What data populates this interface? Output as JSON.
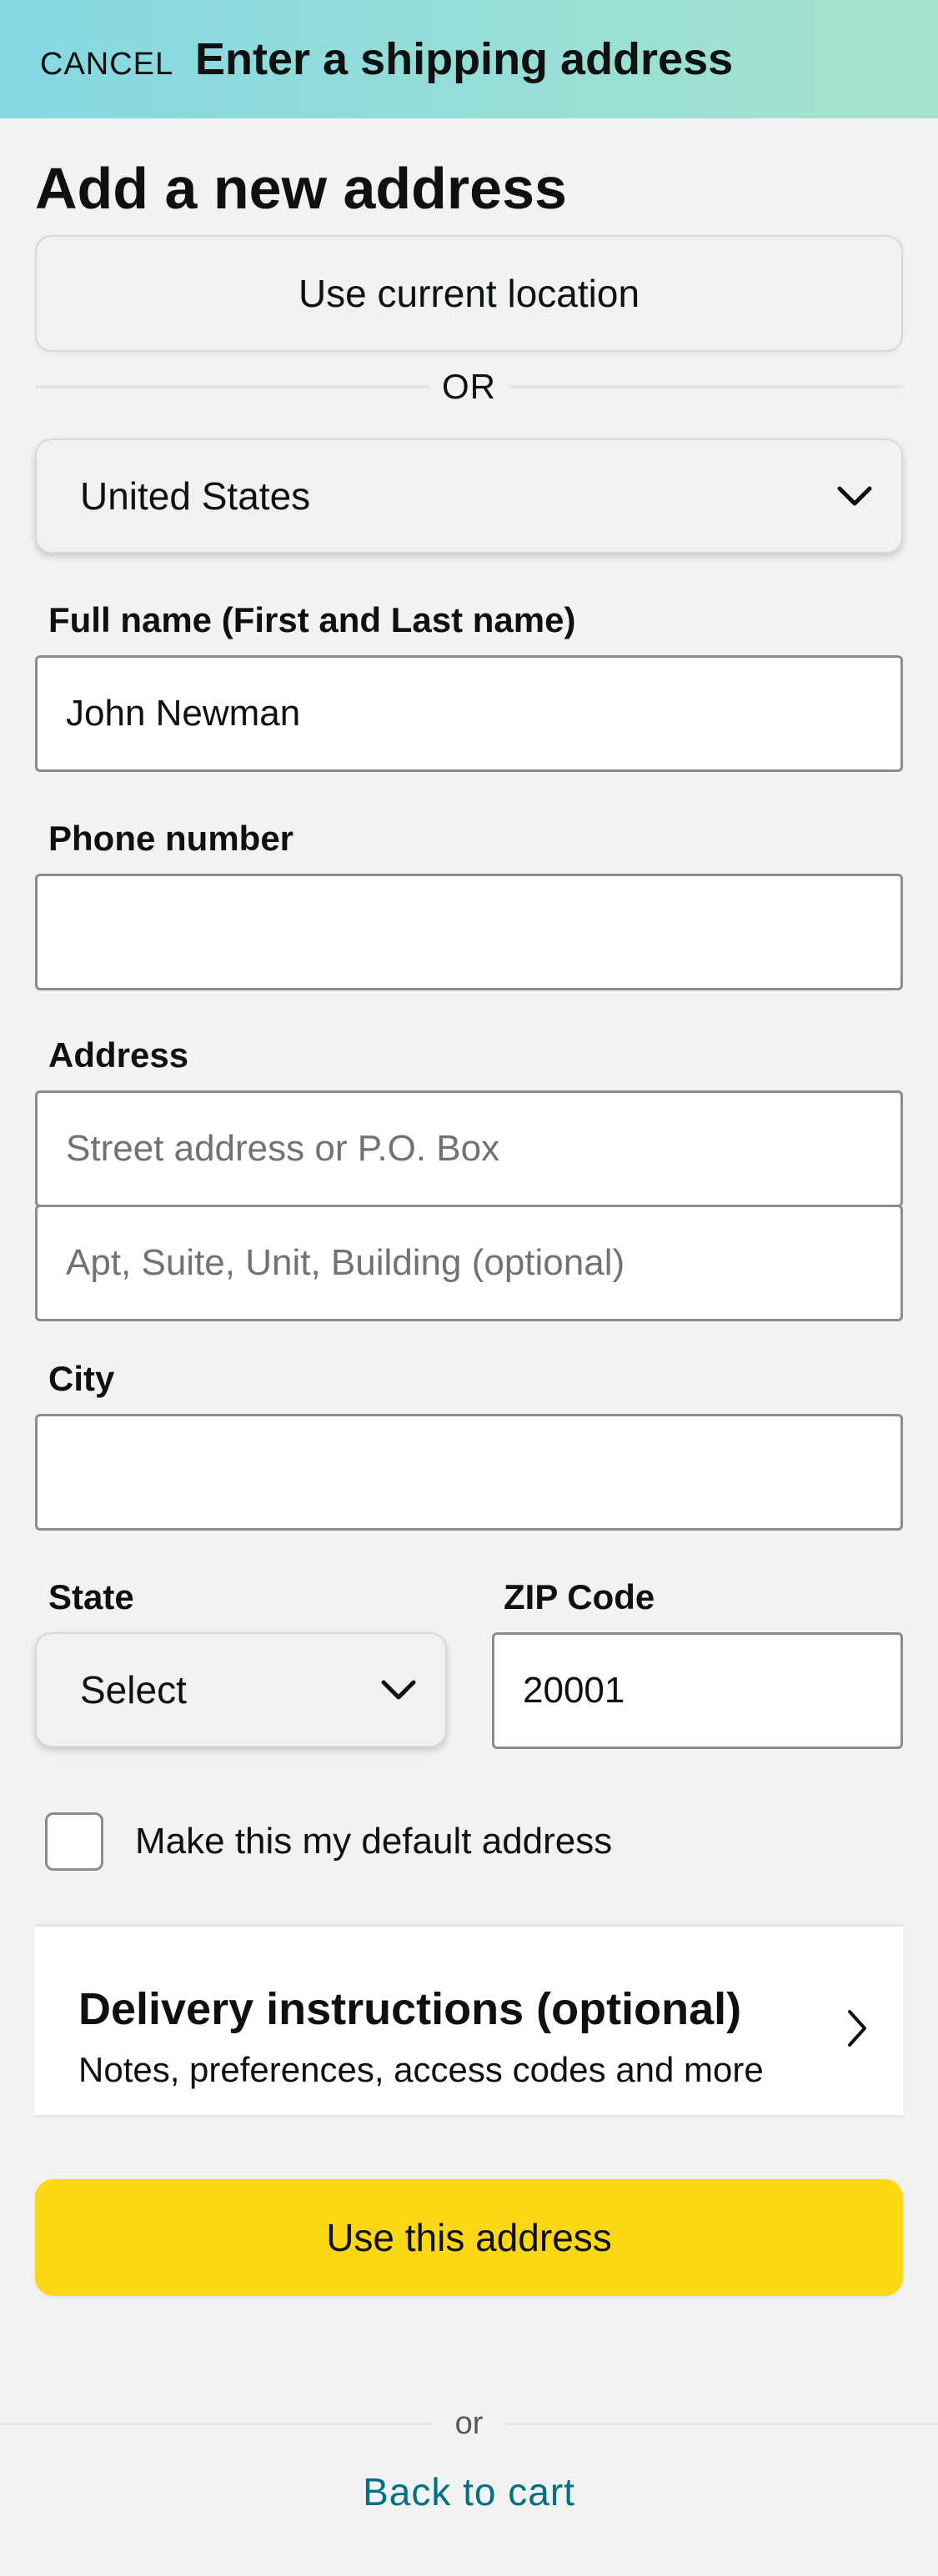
{
  "header": {
    "cancel_label": "CANCEL",
    "title": "Enter a shipping address"
  },
  "form": {
    "heading": "Add a new address",
    "use_location_label": "Use current location",
    "or_label": "OR",
    "country": {
      "selected": "United States"
    },
    "full_name": {
      "label": "Full name (First and Last name)",
      "value": "John Newman"
    },
    "phone": {
      "label": "Phone number",
      "value": ""
    },
    "address": {
      "label": "Address",
      "line1_placeholder": "Street address or P.O. Box",
      "line2_placeholder": "Apt, Suite, Unit, Building (optional)"
    },
    "city": {
      "label": "City",
      "value": ""
    },
    "state": {
      "label": "State",
      "selected": "Select"
    },
    "zip": {
      "label": "ZIP Code",
      "value": "20001"
    },
    "default_checkbox": {
      "label": "Make this my default address",
      "checked": false
    },
    "delivery": {
      "title": "Delivery instructions (optional)",
      "subtitle": "Notes, preferences, access codes and more"
    },
    "submit_label": "Use this address"
  },
  "footer": {
    "or_label": "or",
    "back_label": "Back to cart"
  },
  "colors": {
    "header_gradient_start": "#84d8e3",
    "header_gradient_end": "#a6e3cc",
    "primary_button": "#fcd814",
    "link": "#007185"
  },
  "icons": {
    "dropdown": "chevron-down-icon",
    "delivery": "chevron-right-icon"
  }
}
